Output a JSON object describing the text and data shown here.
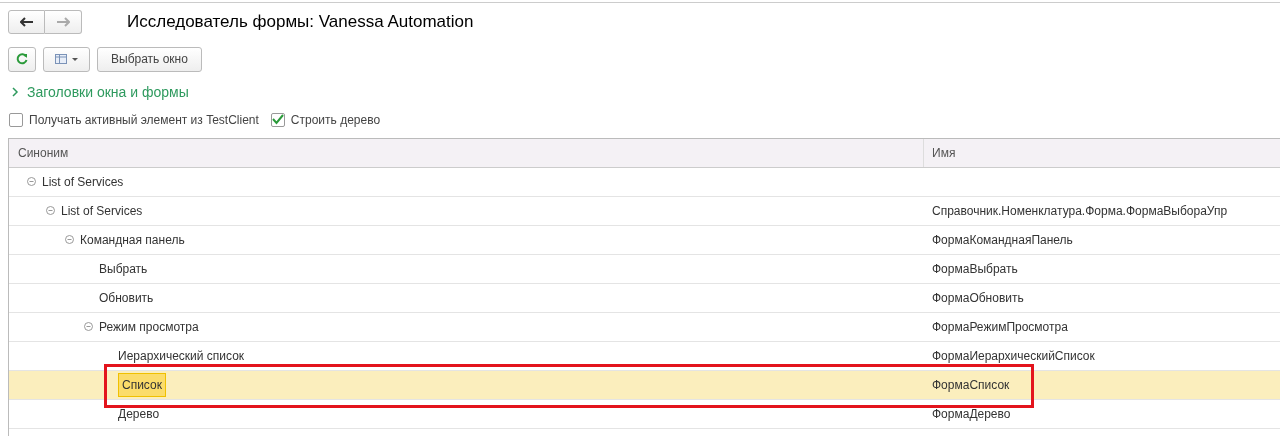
{
  "window": {
    "title": "Исследователь формы: Vanessa Automation"
  },
  "toolbar": {
    "select_window_button": "Выбрать окно"
  },
  "group": {
    "label": "Заголовки окна и формы",
    "expanded": false
  },
  "options": [
    {
      "label": "Получать активный элемент из TestClient",
      "checked": false
    },
    {
      "label": "Строить дерево",
      "checked": true
    }
  ],
  "table": {
    "columns": [
      "Синоним",
      "Имя"
    ],
    "rows": [
      {
        "synonym": "List of Services",
        "name": "",
        "expanded": true,
        "selected": false,
        "highlighted": false,
        "children": [
          {
            "synonym": "List of Services",
            "name": "Справочник.Номенклатура.Форма.ФормаВыбораУпр",
            "expanded": true,
            "selected": false,
            "highlighted": false,
            "children": [
              {
                "synonym": "Командная панель",
                "name": "ФормаКоманднаяПанель",
                "expanded": true,
                "selected": false,
                "highlighted": false,
                "children": [
                  {
                    "synonym": "Выбрать",
                    "name": "ФормаВыбрать",
                    "selected": false,
                    "highlighted": false
                  },
                  {
                    "synonym": "Обновить",
                    "name": "ФормаОбновить",
                    "selected": false,
                    "highlighted": false
                  },
                  {
                    "synonym": "Режим просмотра",
                    "name": "ФормаРежимПросмотра",
                    "expanded": true,
                    "selected": false,
                    "highlighted": false,
                    "children": [
                      {
                        "synonym": "Иерархический список",
                        "name": "ФормаИерархическийСписок",
                        "selected": false,
                        "highlighted": false
                      },
                      {
                        "synonym": "Список",
                        "name": "ФормаСписок",
                        "selected": true,
                        "highlighted": true
                      },
                      {
                        "synonym": "Дерево",
                        "name": "ФормаДерево",
                        "selected": false,
                        "highlighted": false
                      }
                    ]
                  }
                ]
              }
            ]
          }
        ]
      }
    ]
  }
}
